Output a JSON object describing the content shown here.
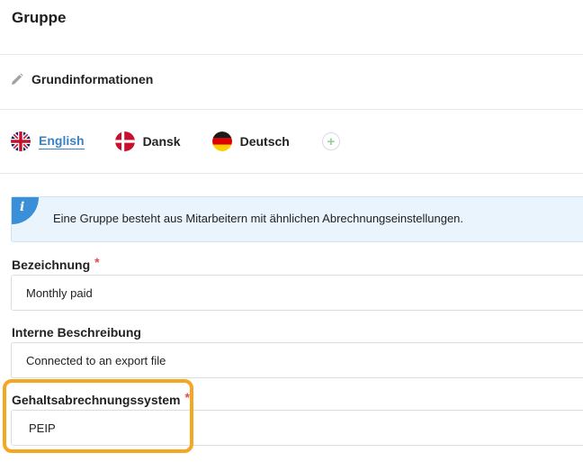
{
  "page": {
    "title": "Gruppe"
  },
  "section": {
    "title": "Grundinformationen"
  },
  "languages": {
    "items": [
      {
        "label": "English",
        "active": true
      },
      {
        "label": "Dansk",
        "active": false
      },
      {
        "label": "Deutsch",
        "active": false
      }
    ],
    "add_label": "+"
  },
  "info": {
    "icon_letter": "i",
    "text": "Eine Gruppe besteht aus Mitarbeitern mit ähnlichen Abrechnungseinstellungen."
  },
  "fields": {
    "bezeichnung": {
      "label": "Bezeichnung",
      "required": "*",
      "value": "Monthly paid"
    },
    "beschreibung": {
      "label": "Interne Beschreibung",
      "value": "Connected to an export file"
    },
    "gehaltssystem": {
      "label": "Gehaltsabrechnungssystem",
      "required": "*",
      "value": "PEIP"
    }
  },
  "colors": {
    "accent": "#3b82c4",
    "highlight": "#f5a623",
    "required": "#e24b4b",
    "info_bg": "#eaf4fc"
  }
}
